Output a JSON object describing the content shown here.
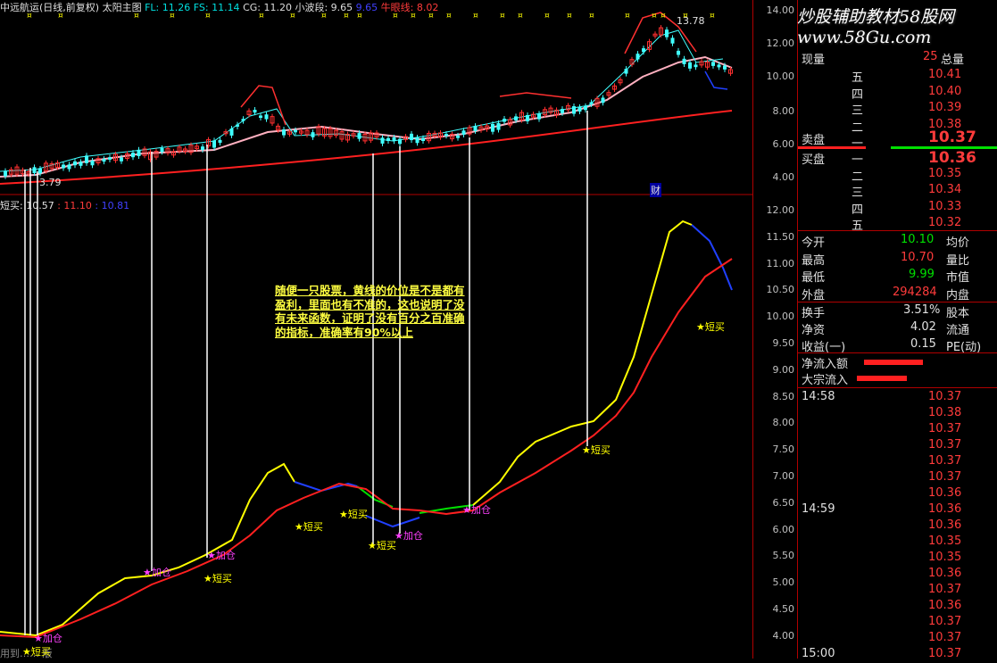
{
  "header": {
    "stock": "中远航运(日线,前复权)",
    "indicator": "太阳主图",
    "fl": "FL: 11.26",
    "fs": "FS: 11.14",
    "cg": "CG: 11.20",
    "wave": "小波段: 9.65",
    "small_blue": "9.65",
    "bull": "牛眼线: 8.02",
    "high_marker": "13.78",
    "low_marker": "3.79",
    "finance_marker": "财"
  },
  "sub_header": {
    "name": "短买",
    "v1": ": 10.57",
    "v2": ": 11.10",
    "v3": ": 10.81"
  },
  "bottom_note": "用到…… 版",
  "upper_axis": [
    "14.00",
    "12.00",
    "10.00",
    "8.00",
    "6.00",
    "4.00"
  ],
  "lower_axis": [
    "12.00",
    "11.50",
    "11.00",
    "10.50",
    "10.00",
    "9.50",
    "9.00",
    "8.50",
    "8.00",
    "7.50",
    "7.00",
    "6.50",
    "6.00",
    "5.50",
    "5.00",
    "4.50",
    "4.00"
  ],
  "annotation": "随便一只股票，黄线的价位是不是都有盈利，里面也有不准的，这也说明了没有未来函数，证明了没有百分之百准确的指标，准确率有90%以上",
  "signals": [
    {
      "text": "★短买",
      "color": "#ffff00"
    },
    {
      "text": "★加仓",
      "color": "#ff40ff"
    },
    {
      "text": "★加仓",
      "color": "#ff40ff"
    },
    {
      "text": "★加仓",
      "color": "#ff40ff"
    },
    {
      "text": "★短买",
      "color": "#ffff00"
    },
    {
      "text": "★短买",
      "color": "#ffff00"
    },
    {
      "text": "★短买",
      "color": "#ffff00"
    },
    {
      "text": "★短买",
      "color": "#ffff00"
    },
    {
      "text": "★加仓",
      "color": "#ff40ff"
    },
    {
      "text": "★加仓",
      "color": "#ff40ff"
    },
    {
      "text": "★短买",
      "color": "#ffff00"
    },
    {
      "text": "★短买",
      "color": "#ffff00"
    }
  ],
  "watermark": "炒股辅助教材58股网 www.58Gu.com",
  "panel": {
    "xianliang": "现量",
    "xianliang_val": "25",
    "zongliang": "总量",
    "sell": [
      {
        "label": "五",
        "price": "10.41"
      },
      {
        "label": "四",
        "price": "10.40"
      },
      {
        "label": "三",
        "price": "10.39"
      },
      {
        "label": "二",
        "price": "10.38"
      },
      {
        "label": "一",
        "price": ""
      }
    ],
    "sell_label": "卖盘",
    "sell_main": "10.37",
    "buy_label": "买盘",
    "buy_main": "10.36",
    "buy": [
      {
        "label": "一",
        "price": ""
      },
      {
        "label": "二",
        "price": "10.35"
      },
      {
        "label": "三",
        "price": "10.34"
      },
      {
        "label": "四",
        "price": "10.33"
      },
      {
        "label": "五",
        "price": "10.32"
      }
    ],
    "stats": [
      {
        "l": "今开",
        "v": "10.10",
        "c": "green",
        "r": "均价"
      },
      {
        "l": "最高",
        "v": "10.70",
        "c": "red",
        "r": "量比"
      },
      {
        "l": "最低",
        "v": "9.99",
        "c": "green",
        "r": "市值"
      },
      {
        "l": "外盘",
        "v": "294284",
        "c": "red",
        "r": "内盘"
      }
    ],
    "stats2": [
      {
        "l": "换手",
        "v": "3.51%",
        "r": "股本"
      },
      {
        "l": "净资",
        "v": "4.02",
        "r": "流通"
      },
      {
        "l": "收益(一)",
        "v": "0.15",
        "r": "PE(动)"
      }
    ],
    "flow1": "净流入额",
    "flow2": "大宗流入",
    "ticks_time1": "14:58",
    "ticks_time2": "14:59",
    "ticks_time3": "15:00",
    "ticks": [
      "10.37",
      "10.38",
      "10.37",
      "10.37",
      "10.37",
      "10.37",
      "10.36",
      "10.36",
      "10.36",
      "10.35",
      "10.35",
      "10.36",
      "10.37",
      "10.36",
      "10.37",
      "10.37",
      "10.37"
    ]
  },
  "colors": {
    "up": "#ff3b3b",
    "down": "#00e000",
    "yellow": "#ffff00",
    "purple": "#ff40ff",
    "grid": "#b00000"
  }
}
